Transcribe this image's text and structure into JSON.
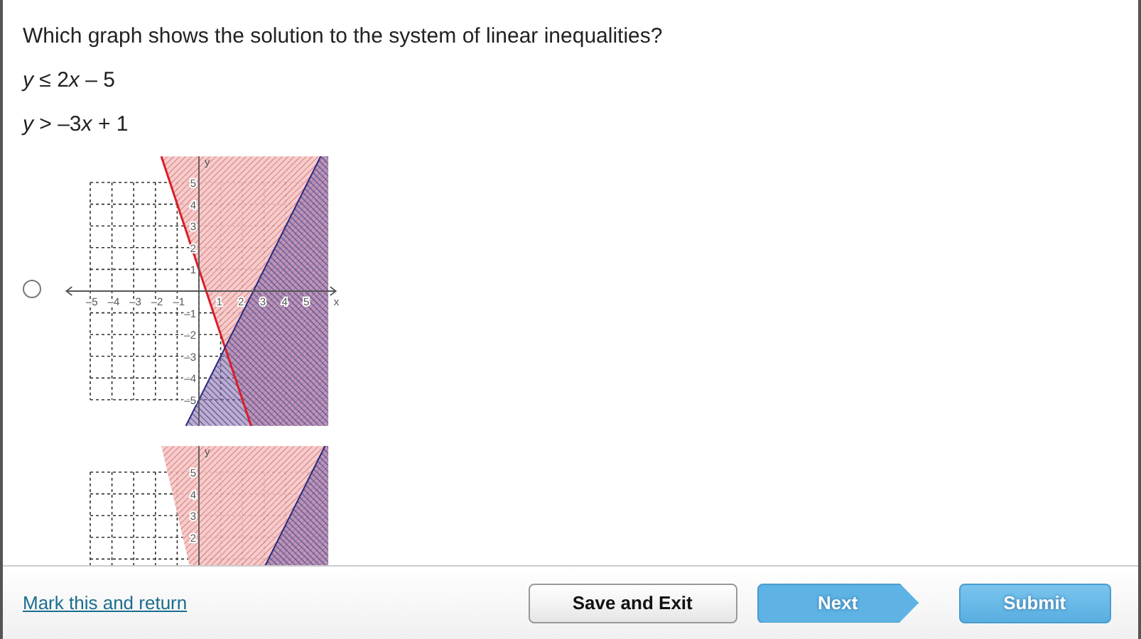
{
  "question": {
    "prompt": "Which graph shows the solution to the system of linear inequalities?",
    "inequalities": [
      [
        {
          "text": "y",
          "italic": true
        },
        {
          "text": " ≤ 2",
          "italic": false
        },
        {
          "text": "x",
          "italic": true
        },
        {
          "text": " – 5",
          "italic": false
        }
      ],
      [
        {
          "text": "y",
          "italic": true
        },
        {
          "text": " > –3",
          "italic": false
        },
        {
          "text": "x",
          "italic": true
        },
        {
          "text": " + 1",
          "italic": false
        }
      ]
    ]
  },
  "options": [
    {
      "selected": false,
      "graph": {
        "x_label": "x",
        "y_label": "y",
        "x_ticks": [
          "–5",
          "–4",
          "–3",
          "–2",
          "–1",
          "1",
          "2",
          "3",
          "4",
          "5"
        ],
        "y_ticks": [
          "5",
          "4",
          "3",
          "2",
          "1",
          "–1",
          "–2",
          "–3",
          "–4",
          "–5"
        ]
      }
    },
    {
      "graph": {
        "y_label": "y",
        "y_ticks": [
          "5",
          "4",
          "3",
          "2"
        ]
      }
    }
  ],
  "footer": {
    "link": "Mark this and return",
    "buttons": [
      {
        "kind": "save",
        "label": "Save and Exit"
      },
      {
        "kind": "next",
        "label": "Next"
      },
      {
        "kind": "submit",
        "label": "Submit"
      }
    ]
  }
}
